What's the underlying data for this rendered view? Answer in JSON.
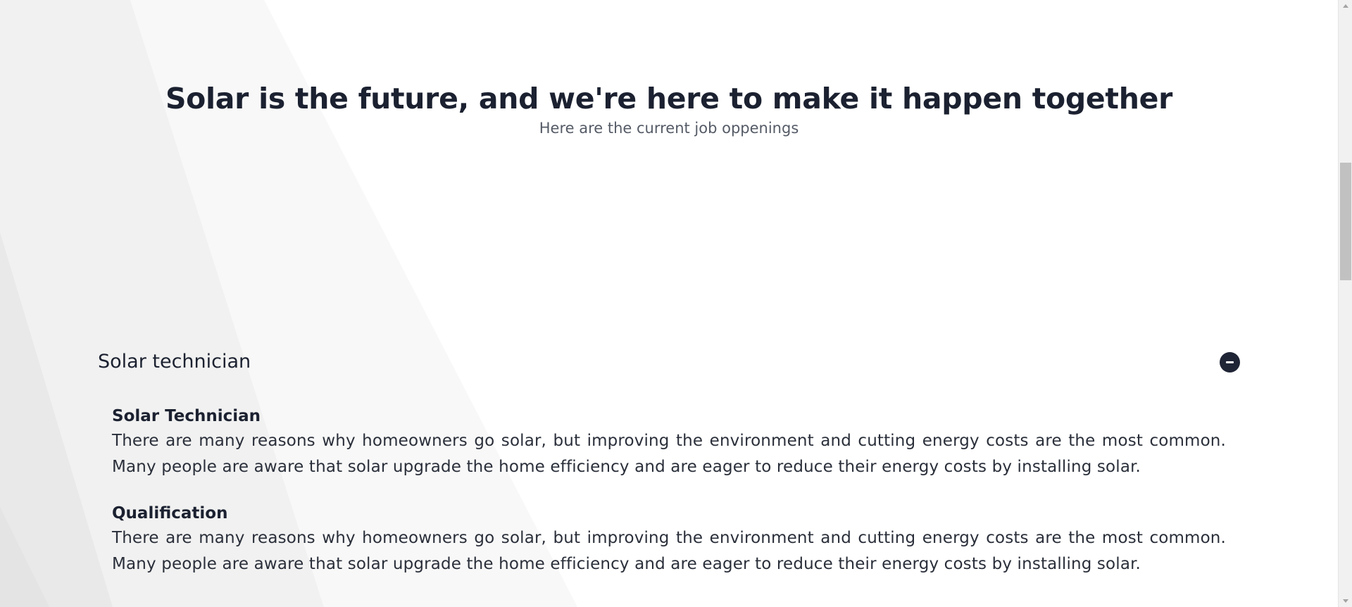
{
  "hero": {
    "title": "Solar is the future, and we're here to make it happen together",
    "subtitle": "Here are the current job oppenings"
  },
  "jobs": [
    {
      "title": "Solar technician",
      "toggle_icon": "minus-circle-icon",
      "expanded": true,
      "sections": [
        {
          "heading": "Solar Technician",
          "text": "There are many reasons why homeowners go solar, but improving the environment and cutting energy costs are the most common. Many people are aware that solar upgrade the home efficiency and are eager to reduce their energy costs by installing solar."
        },
        {
          "heading": "Qualification",
          "text": "There are many reasons why homeowners go solar, but improving the environment and cutting energy costs are the most common. Many people are aware that solar upgrade the home efficiency and are eager to reduce their energy costs by installing solar."
        }
      ]
    }
  ],
  "colors": {
    "text_dark": "#1b2130",
    "subtitle": "#555b66",
    "toggle_bg": "#1f2535",
    "background": "#ffffff",
    "stripe_light": "#f7f7f7",
    "stripe_mid": "#efefef"
  }
}
